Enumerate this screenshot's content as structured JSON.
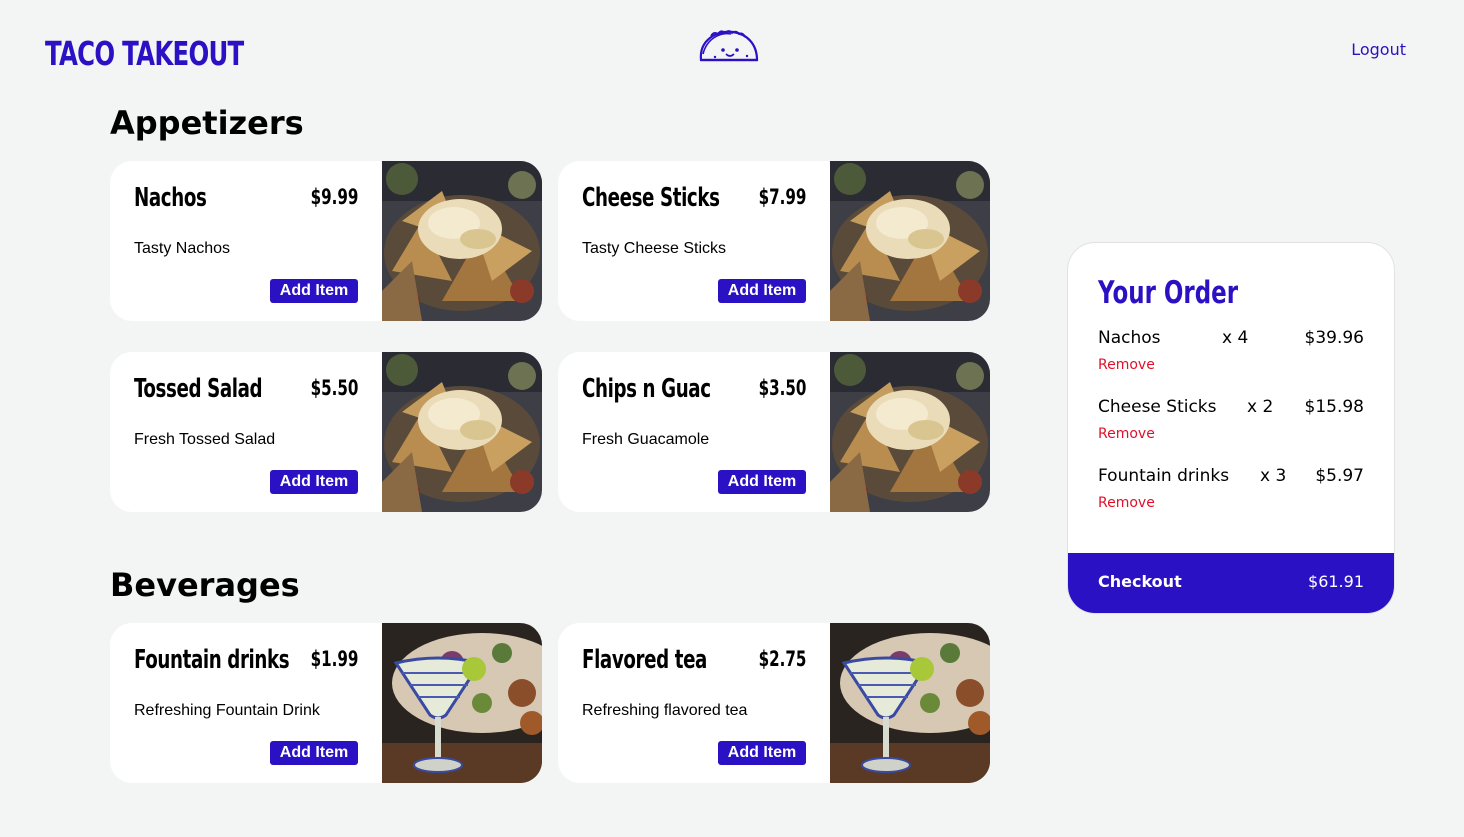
{
  "header": {
    "brand": "TACO TAKEOUT",
    "logout_label": "Logout"
  },
  "sections": [
    {
      "title": "Appetizers",
      "items": [
        {
          "name": "Nachos",
          "price": "$9.99",
          "description": "Tasty Nachos",
          "button": "Add Item",
          "image": "nachos-photo"
        },
        {
          "name": "Cheese Sticks",
          "price": "$7.99",
          "description": "Tasty Cheese Sticks",
          "button": "Add Item",
          "image": "nachos-photo"
        },
        {
          "name": "Tossed Salad",
          "price": "$5.50",
          "description": "Fresh Tossed Salad",
          "button": "Add Item",
          "image": "nachos-photo"
        },
        {
          "name": "Chips n Guac",
          "price": "$3.50",
          "description": "Fresh Guacamole",
          "button": "Add Item",
          "image": "nachos-photo"
        }
      ]
    },
    {
      "title": "Beverages",
      "items": [
        {
          "name": "Fountain drinks",
          "price": "$1.99",
          "description": "Refreshing Fountain Drink",
          "button": "Add Item",
          "image": "margarita-photo"
        },
        {
          "name": "Flavored tea",
          "price": "$2.75",
          "description": "Refreshing flavored tea",
          "button": "Add Item",
          "image": "margarita-photo"
        }
      ]
    }
  ],
  "order": {
    "title": "Your Order",
    "items": [
      {
        "name": "Nachos",
        "qty": "x 4",
        "price": "$39.96",
        "remove": "Remove"
      },
      {
        "name": "Cheese Sticks",
        "qty": "x 2",
        "price": "$15.98",
        "remove": "Remove"
      },
      {
        "name": "Fountain drinks",
        "qty": "x 3",
        "price": "$5.97",
        "remove": "Remove"
      }
    ],
    "checkout_label": "Checkout",
    "total": "$61.91"
  },
  "colors": {
    "accent": "#2a12c4",
    "remove": "#e0102a",
    "background": "#f3f4f4"
  }
}
